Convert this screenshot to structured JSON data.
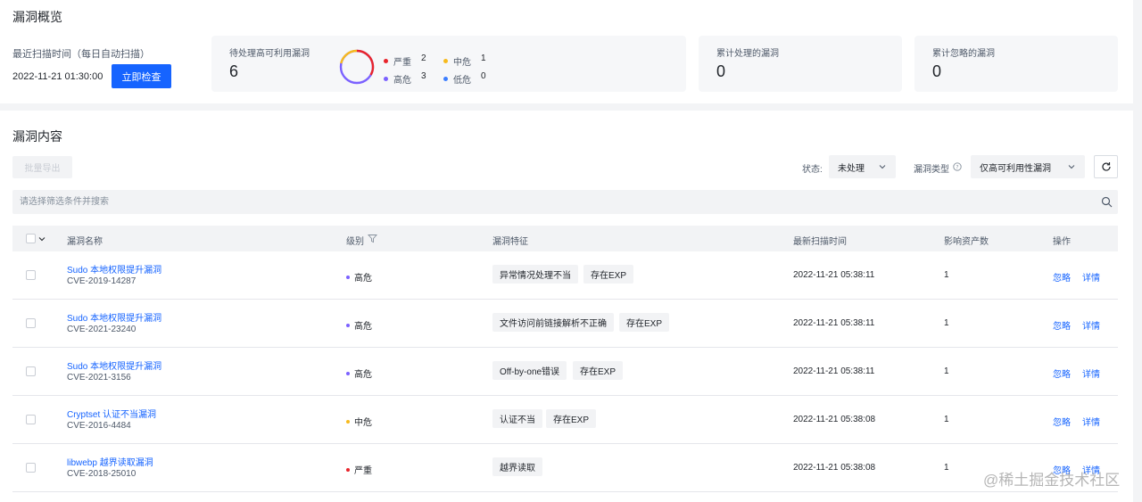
{
  "overview": {
    "title": "漏洞概览",
    "scan_label": "最近扫描时间（每日自动扫描）",
    "scan_time": "2022-11-21 01:30:00",
    "check_now_label": "立即检查",
    "pending": {
      "label": "待处理高可利用漏洞",
      "value": "6",
      "legend": [
        {
          "name": "严重",
          "count": "2",
          "color": "#e8242b"
        },
        {
          "name": "中危",
          "count": "1",
          "color": "#f7ba1e"
        },
        {
          "name": "高危",
          "count": "3",
          "color": "#7b61ff"
        },
        {
          "name": "低危",
          "count": "0",
          "color": "#3c7eff"
        }
      ]
    },
    "handled": {
      "label": "累计处理的漏洞",
      "value": "0"
    },
    "ignored": {
      "label": "累计忽略的漏洞",
      "value": "0"
    }
  },
  "content": {
    "title": "漏洞内容",
    "batch_export_label": "批量导出",
    "status_label": "状态:",
    "status_value": "未处理",
    "type_label": "漏洞类型",
    "type_value": "仅高可利用性漏洞",
    "search_placeholder": "请选择筛选条件并搜索",
    "columns": {
      "name": "漏洞名称",
      "level": "级别",
      "features": "漏洞特征",
      "scan_time": "最新扫描时间",
      "assets": "影响资产数",
      "actions": "操作"
    },
    "ignore_label": "忽略",
    "detail_label": "详情",
    "rows": [
      {
        "name": "Sudo 本地权限提升漏洞",
        "cve": "CVE-2019-14287",
        "level": "高危",
        "level_color": "#7b61ff",
        "tags": [
          "异常情况处理不当",
          "存在EXP"
        ],
        "scan_time": "2022-11-21 05:38:11",
        "assets": "1"
      },
      {
        "name": "Sudo 本地权限提升漏洞",
        "cve": "CVE-2021-23240",
        "level": "高危",
        "level_color": "#7b61ff",
        "tags": [
          "文件访问前链接解析不正确",
          "存在EXP"
        ],
        "scan_time": "2022-11-21 05:38:11",
        "assets": "1"
      },
      {
        "name": "Sudo 本地权限提升漏洞",
        "cve": "CVE-2021-3156",
        "level": "高危",
        "level_color": "#7b61ff",
        "tags": [
          "Off-by-one错误",
          "存在EXP"
        ],
        "scan_time": "2022-11-21 05:38:11",
        "assets": "1"
      },
      {
        "name": "Cryptset 认证不当漏洞",
        "cve": "CVE-2016-4484",
        "level": "中危",
        "level_color": "#f7ba1e",
        "tags": [
          "认证不当",
          "存在EXP"
        ],
        "scan_time": "2022-11-21 05:38:08",
        "assets": "1"
      },
      {
        "name": "libwebp 越界读取漏洞",
        "cve": "CVE-2018-25010",
        "level": "严重",
        "level_color": "#e8242b",
        "tags": [
          "越界读取"
        ],
        "scan_time": "2022-11-21 05:38:08",
        "assets": "1"
      }
    ]
  },
  "watermark": "@稀土掘金技术社区"
}
